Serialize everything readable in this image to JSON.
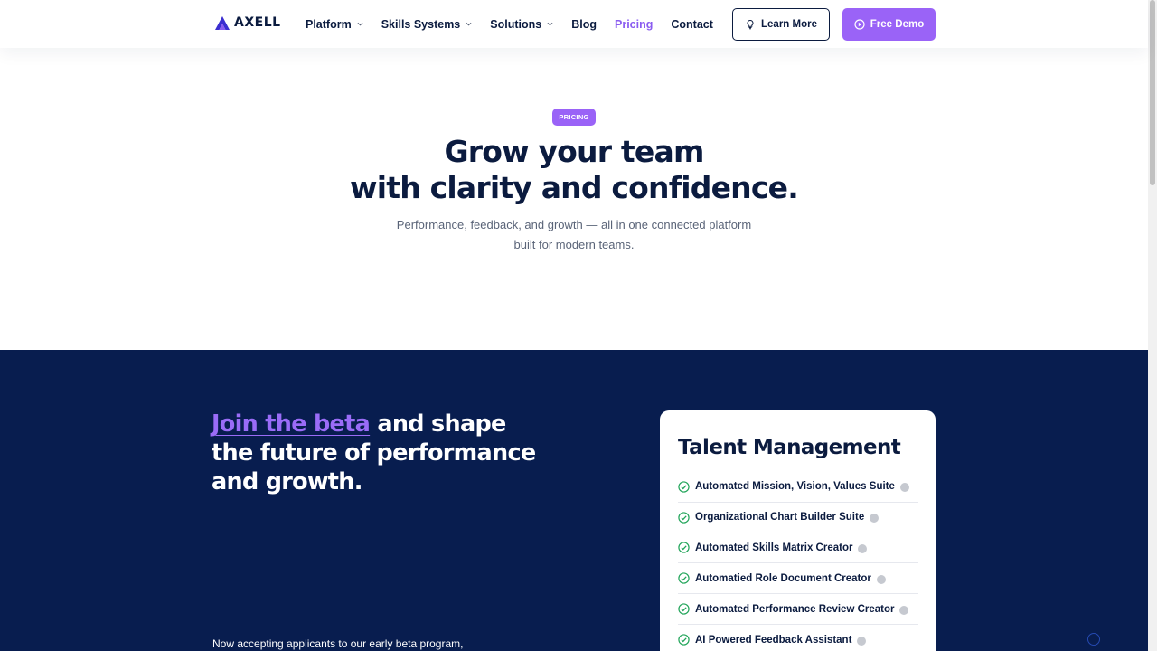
{
  "header": {
    "brand": "AXELL",
    "nav": [
      {
        "label": "Platform",
        "dropdown": true,
        "active": false
      },
      {
        "label": "Skills Systems",
        "dropdown": true,
        "active": false
      },
      {
        "label": "Solutions",
        "dropdown": true,
        "active": false
      },
      {
        "label": "Blog",
        "dropdown": false,
        "active": false
      },
      {
        "label": "Pricing",
        "dropdown": false,
        "active": true
      },
      {
        "label": "Contact",
        "dropdown": false,
        "active": false
      }
    ],
    "learn_more": "Learn More",
    "free_demo": "Free Demo"
  },
  "hero": {
    "badge": "PRICING",
    "title_line1": "Grow your team",
    "title_line2": "with clarity and confidence.",
    "subtitle_line1": "Performance, feedback, and growth — all in one connected platform",
    "subtitle_line2": "built for modern teams."
  },
  "beta": {
    "highlight": "Join the beta",
    "rest": " and shape the future of performance and growth.",
    "text": "Now accepting applicants to our early beta program,"
  },
  "card": {
    "title": "Talent Management",
    "features": [
      "Automated Mission, Vision, Values Suite",
      "Organizational Chart Builder Suite",
      "Automated Skills Matrix Creator",
      "Automatied Role Document Creator",
      "Automated Performance Review Creator",
      "AI Powered Feedback Assistant"
    ]
  },
  "colors": {
    "accent": "#9a63f7",
    "navy": "#081d4f",
    "text": "#0b1b3f",
    "check": "#22a55a"
  }
}
